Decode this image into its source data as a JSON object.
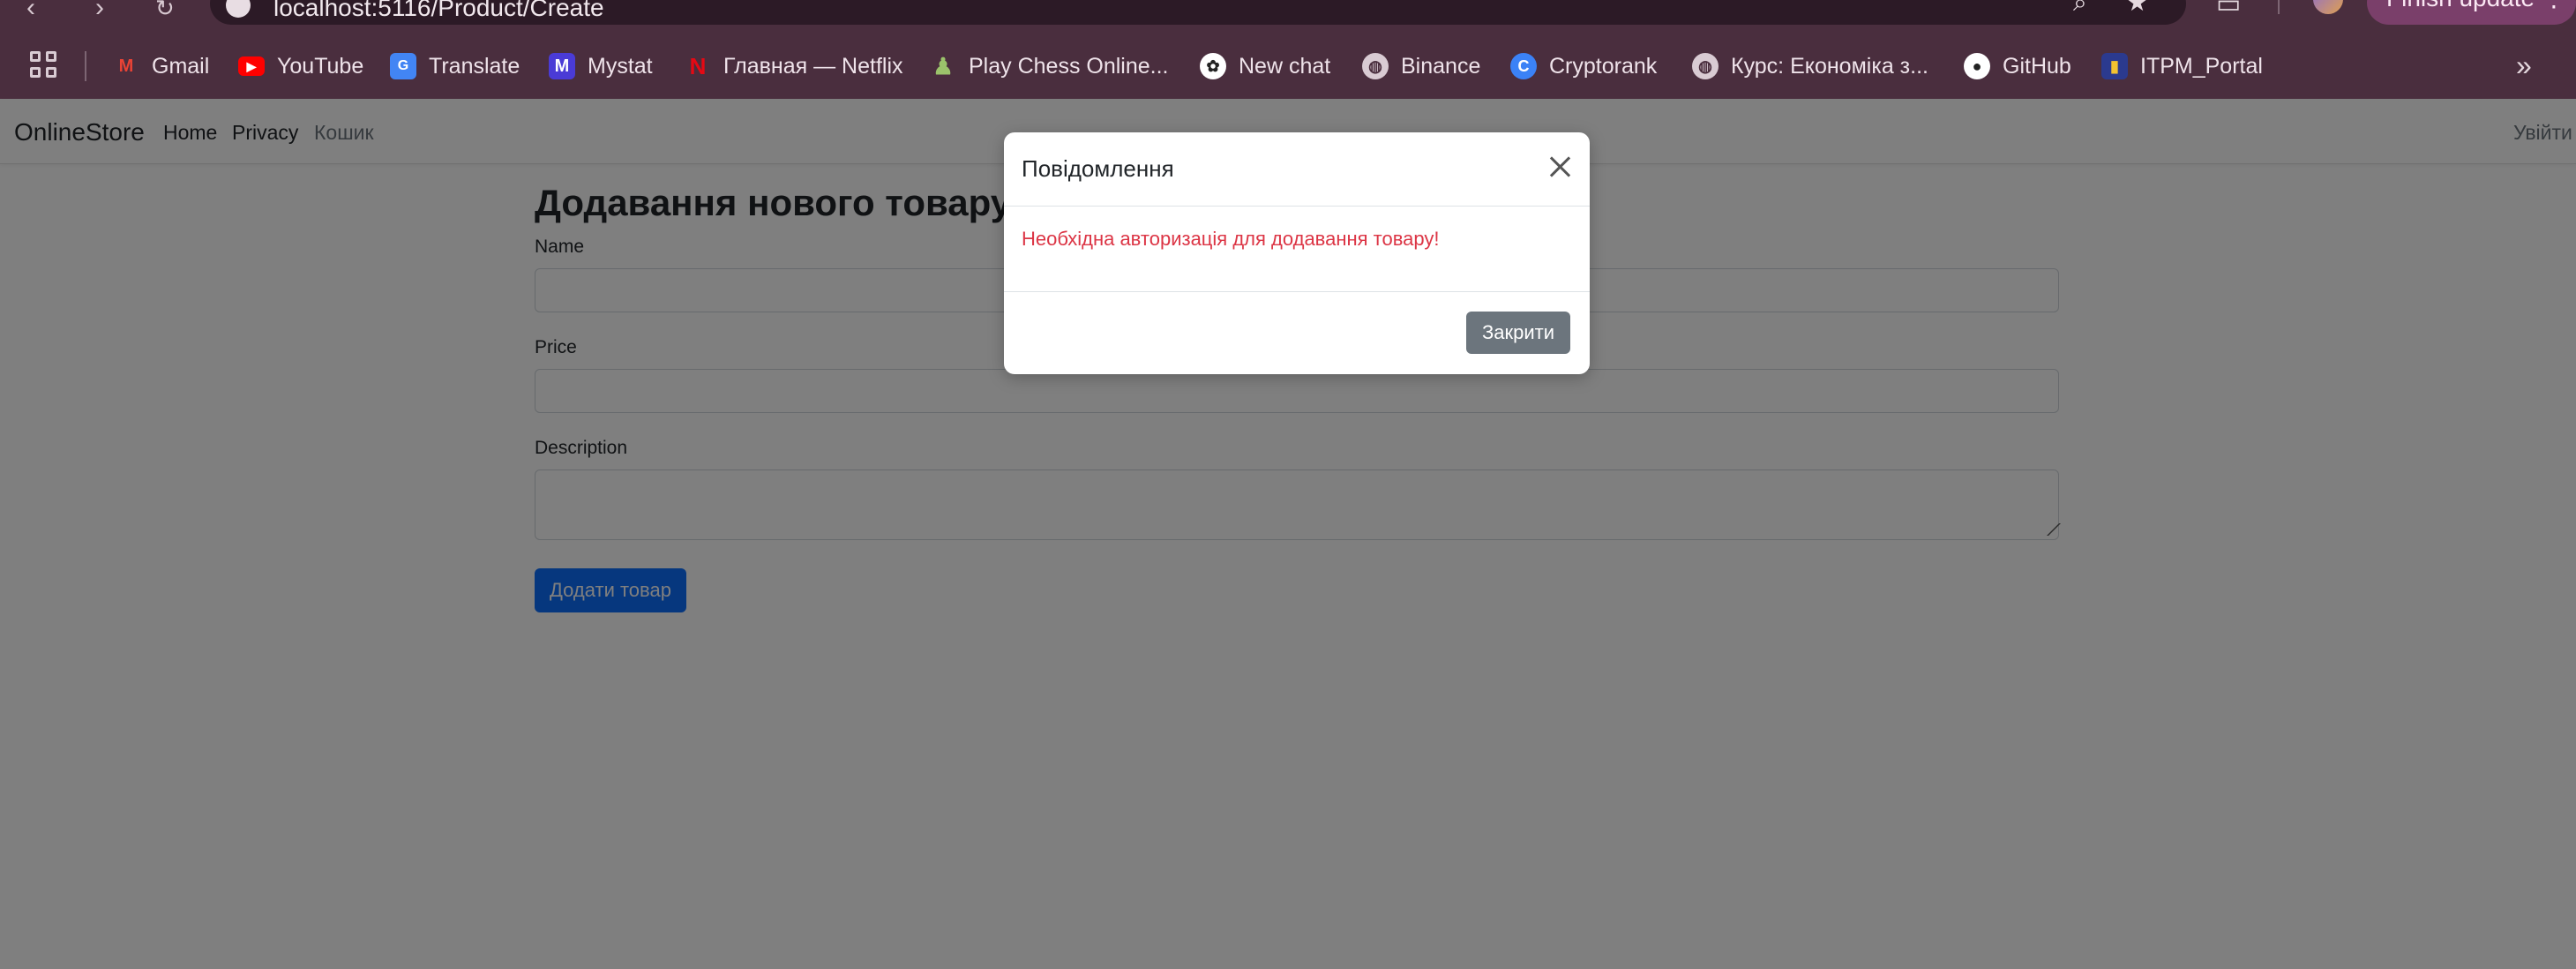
{
  "browser": {
    "url": "localhost:5116/Product/Create",
    "update_label": "Finish update",
    "bookmarks": [
      {
        "label": "Gmail",
        "icon": "gmail-icon",
        "color": "#ea4335"
      },
      {
        "label": "YouTube",
        "icon": "youtube-icon",
        "color": "#ff0000"
      },
      {
        "label": "Translate",
        "icon": "translate-icon",
        "color": "#4285f4"
      },
      {
        "label": "Mystat",
        "icon": "mystat-icon",
        "color": "#4a3bd6"
      },
      {
        "label": "Главная — Netflix",
        "icon": "netflix-icon",
        "color": "#e50914"
      },
      {
        "label": "Play Chess Online...",
        "icon": "chess-pawn-icon",
        "color": "#7fa650"
      },
      {
        "label": "New chat",
        "icon": "openai-icon",
        "color": "#ffffff"
      },
      {
        "label": "Binance",
        "icon": "globe-icon",
        "color": "#d9cbd3"
      },
      {
        "label": "Cryptorank",
        "icon": "cryptorank-icon",
        "color": "#3b82f6"
      },
      {
        "label": "Курс: Економіка з...",
        "icon": "globe-icon",
        "color": "#d9cbd3"
      },
      {
        "label": "GitHub",
        "icon": "github-icon",
        "color": "#ffffff"
      },
      {
        "label": "ITPM_Portal",
        "icon": "itpm-icon",
        "color": "#f2c230"
      }
    ]
  },
  "navbar": {
    "brand": "OnlineStore",
    "links": [
      "Home",
      "Privacy",
      "Кошик"
    ],
    "logout": "Увійти"
  },
  "form": {
    "title": "Додавання нового товару",
    "name_label": "Name",
    "price_label": "Price",
    "description_label": "Description",
    "submit_label": "Додати товар"
  },
  "modal": {
    "title": "Повідомлення",
    "message": "Необхідна авторизація для додавання товару!",
    "close_label": "Закрити"
  },
  "colors": {
    "chrome_bg": "#4a2e3e",
    "primary": "#0d6efd",
    "danger": "#dc3545",
    "secondary": "#6c757d"
  }
}
